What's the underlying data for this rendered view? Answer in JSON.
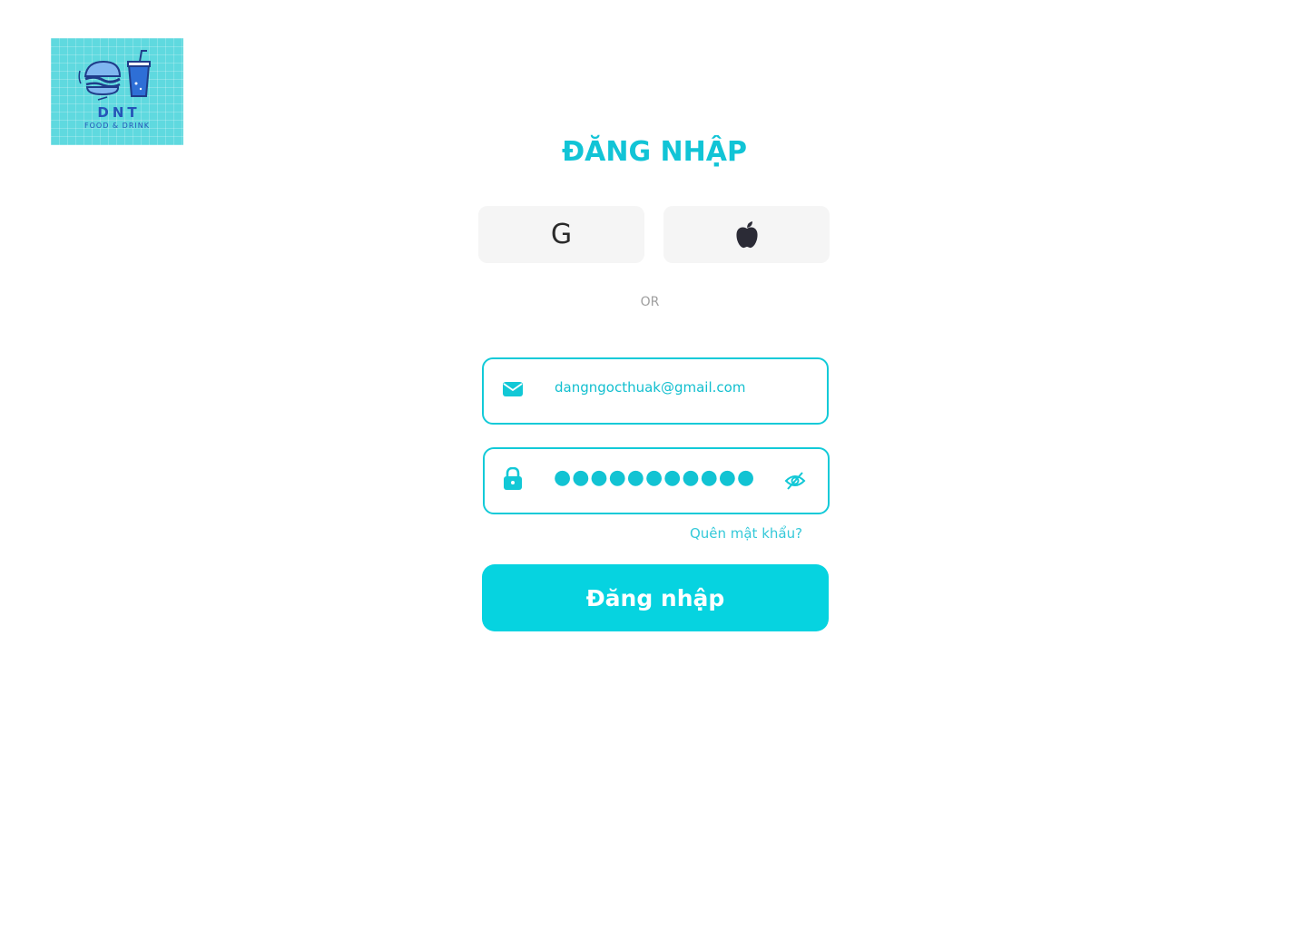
{
  "brand": {
    "name": "DNT",
    "tagline": "FOOD & DRINK"
  },
  "title": "ĐĂNG NHẬP",
  "social": {
    "google_label": "G",
    "google_icon": "google-icon",
    "apple_icon": "apple-icon"
  },
  "divider_text": "OR",
  "email": {
    "icon": "envelope-icon",
    "value": "dangngocthuak@gmail.com"
  },
  "password": {
    "icon": "lock-icon",
    "masked_value": "●●●●●●●●●●●",
    "toggle_icon": "eye-slash-icon"
  },
  "forgot_password": "Quên mật khẩu?",
  "submit_label": "Đăng nhập",
  "colors": {
    "accent": "#06d3e0",
    "accent_text": "#11c4d6",
    "social_bg": "#f5f5f5",
    "logo_bg": "#5fd9df",
    "logo_text": "#2554b8"
  }
}
